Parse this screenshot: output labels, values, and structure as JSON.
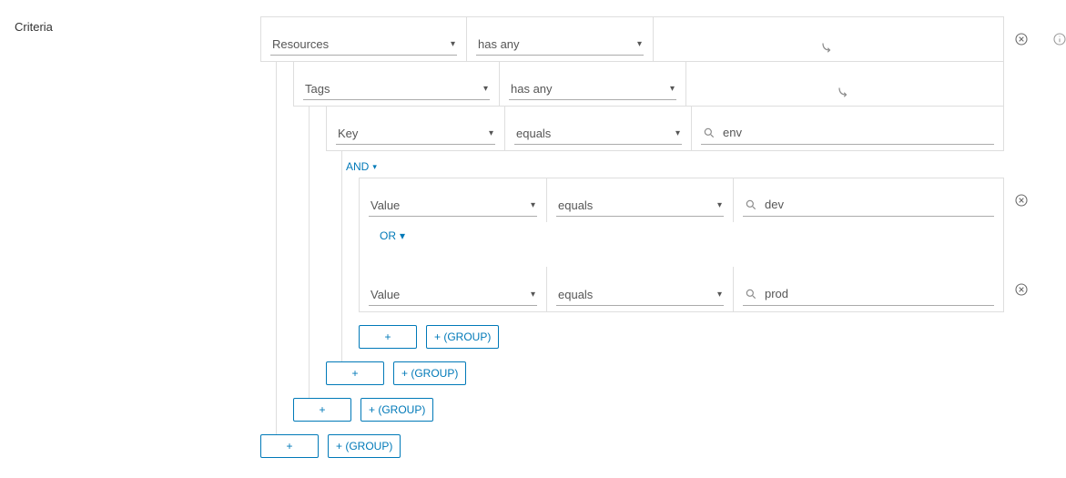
{
  "labels": {
    "criteria": "Criteria"
  },
  "connectors": {
    "and": "AND",
    "or": "OR"
  },
  "buttons": {
    "plus": "+",
    "plus_group": "+ (GROUP)"
  },
  "row1": {
    "field": "Resources",
    "op": "has any"
  },
  "row2": {
    "field": "Tags",
    "op": "has any"
  },
  "row3": {
    "field": "Key",
    "op": "equals",
    "value": "env"
  },
  "row4a": {
    "field": "Value",
    "op": "equals",
    "value": "dev"
  },
  "row4b": {
    "field": "Value",
    "op": "equals",
    "value": "prod"
  }
}
